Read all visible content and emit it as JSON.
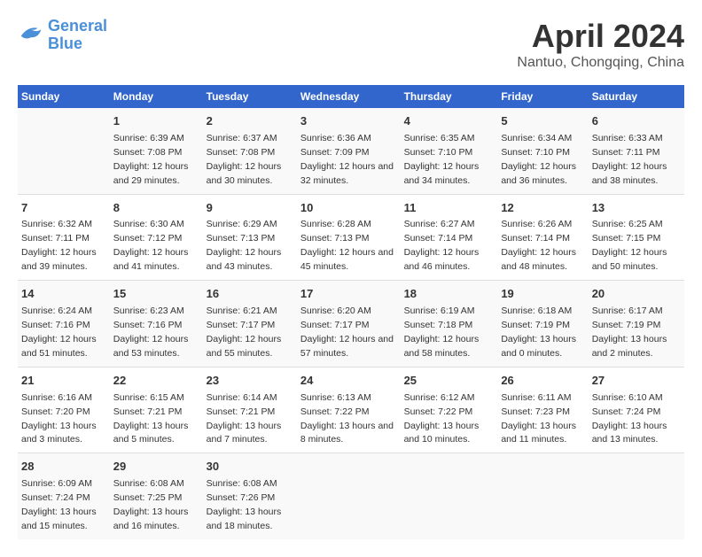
{
  "header": {
    "logo_line1": "General",
    "logo_line2": "Blue",
    "title": "April 2024",
    "subtitle": "Nantuo, Chongqing, China"
  },
  "days_of_week": [
    "Sunday",
    "Monday",
    "Tuesday",
    "Wednesday",
    "Thursday",
    "Friday",
    "Saturday"
  ],
  "weeks": [
    [
      {
        "day": "",
        "sunrise": "",
        "sunset": "",
        "daylight": ""
      },
      {
        "day": "1",
        "sunrise": "Sunrise: 6:39 AM",
        "sunset": "Sunset: 7:08 PM",
        "daylight": "Daylight: 12 hours and 29 minutes."
      },
      {
        "day": "2",
        "sunrise": "Sunrise: 6:37 AM",
        "sunset": "Sunset: 7:08 PM",
        "daylight": "Daylight: 12 hours and 30 minutes."
      },
      {
        "day": "3",
        "sunrise": "Sunrise: 6:36 AM",
        "sunset": "Sunset: 7:09 PM",
        "daylight": "Daylight: 12 hours and 32 minutes."
      },
      {
        "day": "4",
        "sunrise": "Sunrise: 6:35 AM",
        "sunset": "Sunset: 7:10 PM",
        "daylight": "Daylight: 12 hours and 34 minutes."
      },
      {
        "day": "5",
        "sunrise": "Sunrise: 6:34 AM",
        "sunset": "Sunset: 7:10 PM",
        "daylight": "Daylight: 12 hours and 36 minutes."
      },
      {
        "day": "6",
        "sunrise": "Sunrise: 6:33 AM",
        "sunset": "Sunset: 7:11 PM",
        "daylight": "Daylight: 12 hours and 38 minutes."
      }
    ],
    [
      {
        "day": "7",
        "sunrise": "Sunrise: 6:32 AM",
        "sunset": "Sunset: 7:11 PM",
        "daylight": "Daylight: 12 hours and 39 minutes."
      },
      {
        "day": "8",
        "sunrise": "Sunrise: 6:30 AM",
        "sunset": "Sunset: 7:12 PM",
        "daylight": "Daylight: 12 hours and 41 minutes."
      },
      {
        "day": "9",
        "sunrise": "Sunrise: 6:29 AM",
        "sunset": "Sunset: 7:13 PM",
        "daylight": "Daylight: 12 hours and 43 minutes."
      },
      {
        "day": "10",
        "sunrise": "Sunrise: 6:28 AM",
        "sunset": "Sunset: 7:13 PM",
        "daylight": "Daylight: 12 hours and 45 minutes."
      },
      {
        "day": "11",
        "sunrise": "Sunrise: 6:27 AM",
        "sunset": "Sunset: 7:14 PM",
        "daylight": "Daylight: 12 hours and 46 minutes."
      },
      {
        "day": "12",
        "sunrise": "Sunrise: 6:26 AM",
        "sunset": "Sunset: 7:14 PM",
        "daylight": "Daylight: 12 hours and 48 minutes."
      },
      {
        "day": "13",
        "sunrise": "Sunrise: 6:25 AM",
        "sunset": "Sunset: 7:15 PM",
        "daylight": "Daylight: 12 hours and 50 minutes."
      }
    ],
    [
      {
        "day": "14",
        "sunrise": "Sunrise: 6:24 AM",
        "sunset": "Sunset: 7:16 PM",
        "daylight": "Daylight: 12 hours and 51 minutes."
      },
      {
        "day": "15",
        "sunrise": "Sunrise: 6:23 AM",
        "sunset": "Sunset: 7:16 PM",
        "daylight": "Daylight: 12 hours and 53 minutes."
      },
      {
        "day": "16",
        "sunrise": "Sunrise: 6:21 AM",
        "sunset": "Sunset: 7:17 PM",
        "daylight": "Daylight: 12 hours and 55 minutes."
      },
      {
        "day": "17",
        "sunrise": "Sunrise: 6:20 AM",
        "sunset": "Sunset: 7:17 PM",
        "daylight": "Daylight: 12 hours and 57 minutes."
      },
      {
        "day": "18",
        "sunrise": "Sunrise: 6:19 AM",
        "sunset": "Sunset: 7:18 PM",
        "daylight": "Daylight: 12 hours and 58 minutes."
      },
      {
        "day": "19",
        "sunrise": "Sunrise: 6:18 AM",
        "sunset": "Sunset: 7:19 PM",
        "daylight": "Daylight: 13 hours and 0 minutes."
      },
      {
        "day": "20",
        "sunrise": "Sunrise: 6:17 AM",
        "sunset": "Sunset: 7:19 PM",
        "daylight": "Daylight: 13 hours and 2 minutes."
      }
    ],
    [
      {
        "day": "21",
        "sunrise": "Sunrise: 6:16 AM",
        "sunset": "Sunset: 7:20 PM",
        "daylight": "Daylight: 13 hours and 3 minutes."
      },
      {
        "day": "22",
        "sunrise": "Sunrise: 6:15 AM",
        "sunset": "Sunset: 7:21 PM",
        "daylight": "Daylight: 13 hours and 5 minutes."
      },
      {
        "day": "23",
        "sunrise": "Sunrise: 6:14 AM",
        "sunset": "Sunset: 7:21 PM",
        "daylight": "Daylight: 13 hours and 7 minutes."
      },
      {
        "day": "24",
        "sunrise": "Sunrise: 6:13 AM",
        "sunset": "Sunset: 7:22 PM",
        "daylight": "Daylight: 13 hours and 8 minutes."
      },
      {
        "day": "25",
        "sunrise": "Sunrise: 6:12 AM",
        "sunset": "Sunset: 7:22 PM",
        "daylight": "Daylight: 13 hours and 10 minutes."
      },
      {
        "day": "26",
        "sunrise": "Sunrise: 6:11 AM",
        "sunset": "Sunset: 7:23 PM",
        "daylight": "Daylight: 13 hours and 11 minutes."
      },
      {
        "day": "27",
        "sunrise": "Sunrise: 6:10 AM",
        "sunset": "Sunset: 7:24 PM",
        "daylight": "Daylight: 13 hours and 13 minutes."
      }
    ],
    [
      {
        "day": "28",
        "sunrise": "Sunrise: 6:09 AM",
        "sunset": "Sunset: 7:24 PM",
        "daylight": "Daylight: 13 hours and 15 minutes."
      },
      {
        "day": "29",
        "sunrise": "Sunrise: 6:08 AM",
        "sunset": "Sunset: 7:25 PM",
        "daylight": "Daylight: 13 hours and 16 minutes."
      },
      {
        "day": "30",
        "sunrise": "Sunrise: 6:08 AM",
        "sunset": "Sunset: 7:26 PM",
        "daylight": "Daylight: 13 hours and 18 minutes."
      },
      {
        "day": "",
        "sunrise": "",
        "sunset": "",
        "daylight": ""
      },
      {
        "day": "",
        "sunrise": "",
        "sunset": "",
        "daylight": ""
      },
      {
        "day": "",
        "sunrise": "",
        "sunset": "",
        "daylight": ""
      },
      {
        "day": "",
        "sunrise": "",
        "sunset": "",
        "daylight": ""
      }
    ]
  ]
}
